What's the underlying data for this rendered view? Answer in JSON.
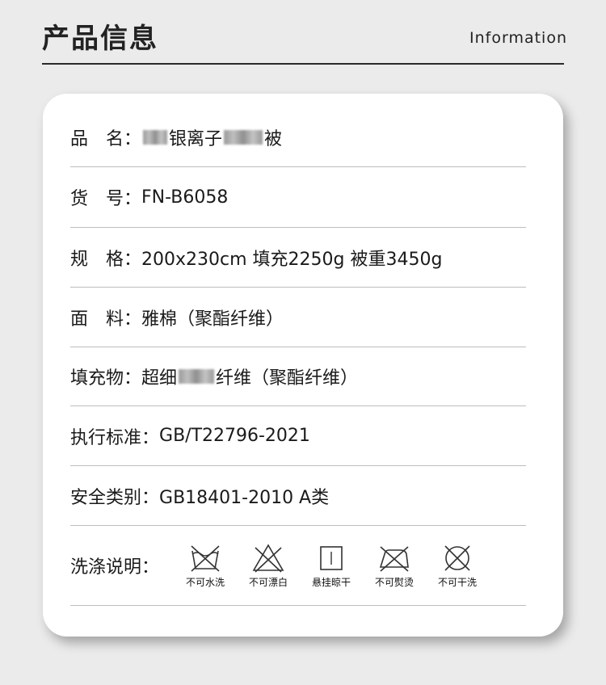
{
  "header": {
    "title": "产品信息",
    "subtitle": "Information"
  },
  "rows": [
    {
      "label": "品　名：",
      "v1": "",
      "v2": "银离子",
      "v3": "被"
    },
    {
      "label": "货　号：",
      "value": "FN-B6058"
    },
    {
      "label": "规　格：",
      "value": "200x230cm 填充2250g 被重3450g"
    },
    {
      "label": "面　料：",
      "value": "雅棉（聚酯纤维）"
    },
    {
      "label": "填充物：",
      "v1": "超细",
      "v2": "纤维（聚酯纤维）"
    },
    {
      "label": "执行标准：",
      "value": "GB/T22796-2021"
    },
    {
      "label": "安全类别：",
      "value": "GB18401-2010 A类"
    }
  ],
  "care": {
    "label": "洗涤说明：",
    "items": [
      {
        "icon": "no-wash-icon",
        "text": "不可水洗"
      },
      {
        "icon": "no-bleach-icon",
        "text": "不可漂白"
      },
      {
        "icon": "hang-dry-icon",
        "text": "悬挂晾干"
      },
      {
        "icon": "no-iron-icon",
        "text": "不可熨烫"
      },
      {
        "icon": "no-dry-clean-icon",
        "text": "不可干洗"
      }
    ]
  }
}
